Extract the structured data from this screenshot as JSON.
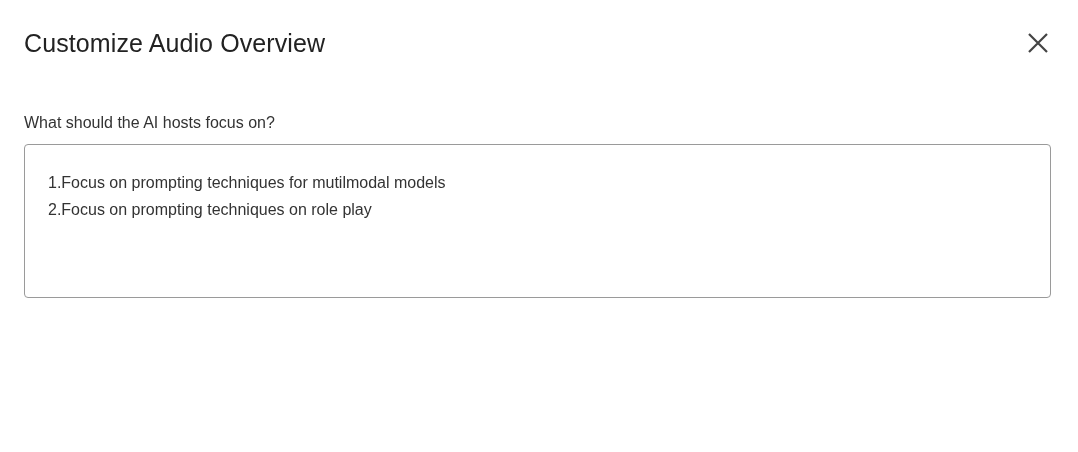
{
  "dialog": {
    "title": "Customize Audio Overview"
  },
  "prompt": {
    "label": "What should the AI hosts focus on?",
    "value": "1.Focus on prompting techniques for mutilmodal models\n2.Focus on prompting techniques on role play"
  }
}
